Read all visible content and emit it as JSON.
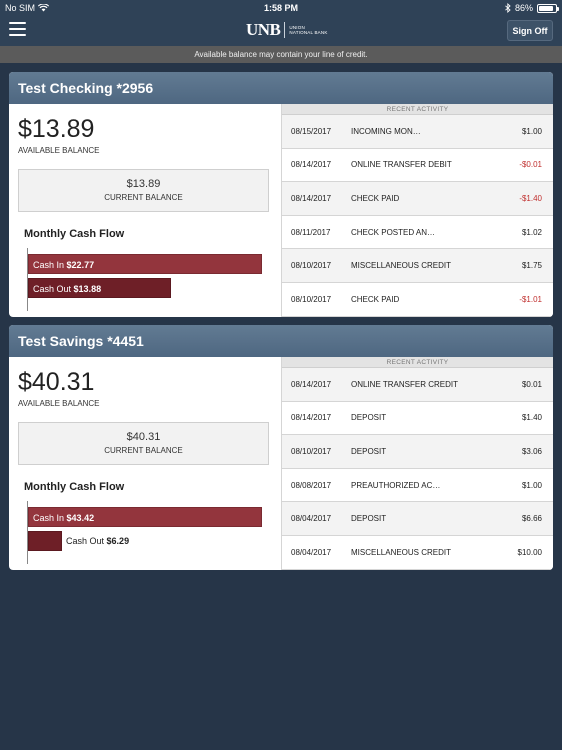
{
  "status_bar": {
    "carrier": "No SIM",
    "time": "1:58 PM",
    "battery": "86%",
    "battery_level": 0.86
  },
  "nav": {
    "logo_mark": "UNB",
    "logo_sub": "UNION NATIONAL BANK",
    "sign_off_label": "Sign Off"
  },
  "notice": "Available balance may contain your line of credit.",
  "accounts": [
    {
      "title": "Test Checking *2956",
      "available_amount": "$13.89",
      "available_label": "AVAILABLE BALANCE",
      "current_amount": "$13.89",
      "current_label": "CURRENT BALANCE",
      "cash_flow_title": "Monthly Cash Flow",
      "cash_in_label": "Cash In",
      "cash_in_value": "$22.77",
      "cash_in_amount": 22.77,
      "cash_out_label": "Cash Out",
      "cash_out_value": "$13.88",
      "cash_out_amount": 13.88,
      "recent_activity_label": "RECENT ACTIVITY",
      "activity": [
        {
          "date": "08/15/2017",
          "desc": "INCOMING MON…",
          "amount": "$1.00",
          "negative": false
        },
        {
          "date": "08/14/2017",
          "desc": "ONLINE TRANSFER DEBIT",
          "amount": "-$0.01",
          "negative": true
        },
        {
          "date": "08/14/2017",
          "desc": "CHECK PAID",
          "amount": "-$1.40",
          "negative": true
        },
        {
          "date": "08/11/2017",
          "desc": "CHECK POSTED AN…",
          "amount": "$1.02",
          "negative": false
        },
        {
          "date": "08/10/2017",
          "desc": "MISCELLANEOUS CREDIT",
          "amount": "$1.75",
          "negative": false
        },
        {
          "date": "08/10/2017",
          "desc": "CHECK PAID",
          "amount": "-$1.01",
          "negative": true
        }
      ]
    },
    {
      "title": "Test Savings *4451",
      "available_amount": "$40.31",
      "available_label": "AVAILABLE BALANCE",
      "current_amount": "$40.31",
      "current_label": "CURRENT BALANCE",
      "cash_flow_title": "Monthly Cash Flow",
      "cash_in_label": "Cash In",
      "cash_in_value": "$43.42",
      "cash_in_amount": 43.42,
      "cash_out_label": "Cash Out",
      "cash_out_value": "$6.29",
      "cash_out_amount": 6.29,
      "recent_activity_label": "RECENT ACTIVITY",
      "activity": [
        {
          "date": "08/14/2017",
          "desc": "ONLINE TRANSFER CREDIT",
          "amount": "$0.01",
          "negative": false
        },
        {
          "date": "08/14/2017",
          "desc": "DEPOSIT",
          "amount": "$1.40",
          "negative": false
        },
        {
          "date": "08/10/2017",
          "desc": "DEPOSIT",
          "amount": "$3.06",
          "negative": false
        },
        {
          "date": "08/08/2017",
          "desc": "PREAUTHORIZED AC…",
          "amount": "$1.00",
          "negative": false
        },
        {
          "date": "08/04/2017",
          "desc": "DEPOSIT",
          "amount": "$6.66",
          "negative": false
        },
        {
          "date": "08/04/2017",
          "desc": "MISCELLANEOUS CREDIT",
          "amount": "$10.00",
          "negative": false
        }
      ]
    }
  ],
  "icons": {
    "menu": "hamburger-menu-icon",
    "wifi": "wifi-icon",
    "bluetooth": "bluetooth-icon",
    "battery": "battery-icon"
  },
  "colors": {
    "background": "#263548",
    "header": "#2f4257",
    "cash_in": "#93353d",
    "cash_out": "#6e1f27",
    "negative": "#c0302f"
  }
}
